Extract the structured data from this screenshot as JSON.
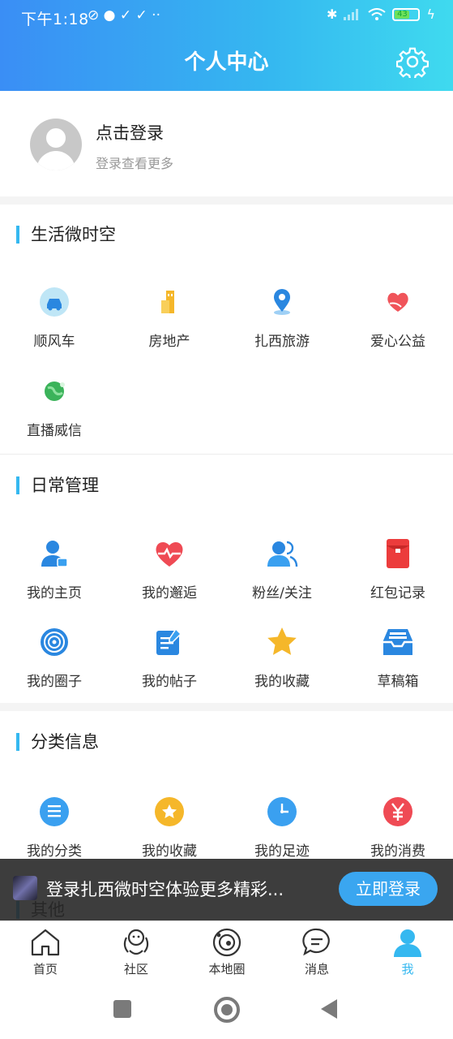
{
  "status_bar": {
    "time": "下午1:18",
    "left_icons": "⊘ ● ✓ ✓ ··",
    "battery": "43"
  },
  "header": {
    "title": "个人中心"
  },
  "profile": {
    "login_title": "点击登录",
    "login_subtitle": "登录查看更多"
  },
  "sections": {
    "life": {
      "title": "生活微时空",
      "items": [
        {
          "label": "顺风车",
          "icon": "car-icon"
        },
        {
          "label": "房地产",
          "icon": "building-icon"
        },
        {
          "label": "扎西旅游",
          "icon": "location-pin-icon"
        },
        {
          "label": "爱心公益",
          "icon": "charity-heart-icon"
        },
        {
          "label": "直播威信",
          "icon": "globe-icon"
        }
      ]
    },
    "daily": {
      "title": "日常管理",
      "items": [
        {
          "label": "我的主页",
          "icon": "user-profile-icon"
        },
        {
          "label": "我的邂逅",
          "icon": "heartbeat-icon"
        },
        {
          "label": "粉丝/关注",
          "icon": "followers-icon"
        },
        {
          "label": "红包记录",
          "icon": "red-envelope-icon"
        },
        {
          "label": "我的圈子",
          "icon": "circle-target-icon"
        },
        {
          "label": "我的帖子",
          "icon": "post-edit-icon"
        },
        {
          "label": "我的收藏",
          "icon": "star-icon"
        },
        {
          "label": "草稿箱",
          "icon": "inbox-tray-icon"
        }
      ]
    },
    "category": {
      "title": "分类信息",
      "items": [
        {
          "label": "我的分类",
          "icon": "list-icon"
        },
        {
          "label": "我的收藏",
          "icon": "favorite-badge-icon"
        },
        {
          "label": "我的足迹",
          "icon": "clock-icon"
        },
        {
          "label": "我的消费",
          "icon": "yen-icon"
        }
      ]
    },
    "other": {
      "title": "其他"
    }
  },
  "banner": {
    "text": "登录扎西微时空体验更多精彩...",
    "button": "立即登录"
  },
  "tabbar": {
    "items": [
      {
        "label": "首页",
        "icon": "home-icon"
      },
      {
        "label": "社区",
        "icon": "community-icon"
      },
      {
        "label": "本地圈",
        "icon": "local-circle-icon"
      },
      {
        "label": "消息",
        "icon": "message-icon"
      },
      {
        "label": "我",
        "icon": "me-icon",
        "active": true
      }
    ]
  },
  "colors": {
    "accent": "#35b8f0",
    "header_start": "#3a8ef5",
    "header_end": "#3fdaef",
    "banner_button": "#3aa6f0"
  }
}
